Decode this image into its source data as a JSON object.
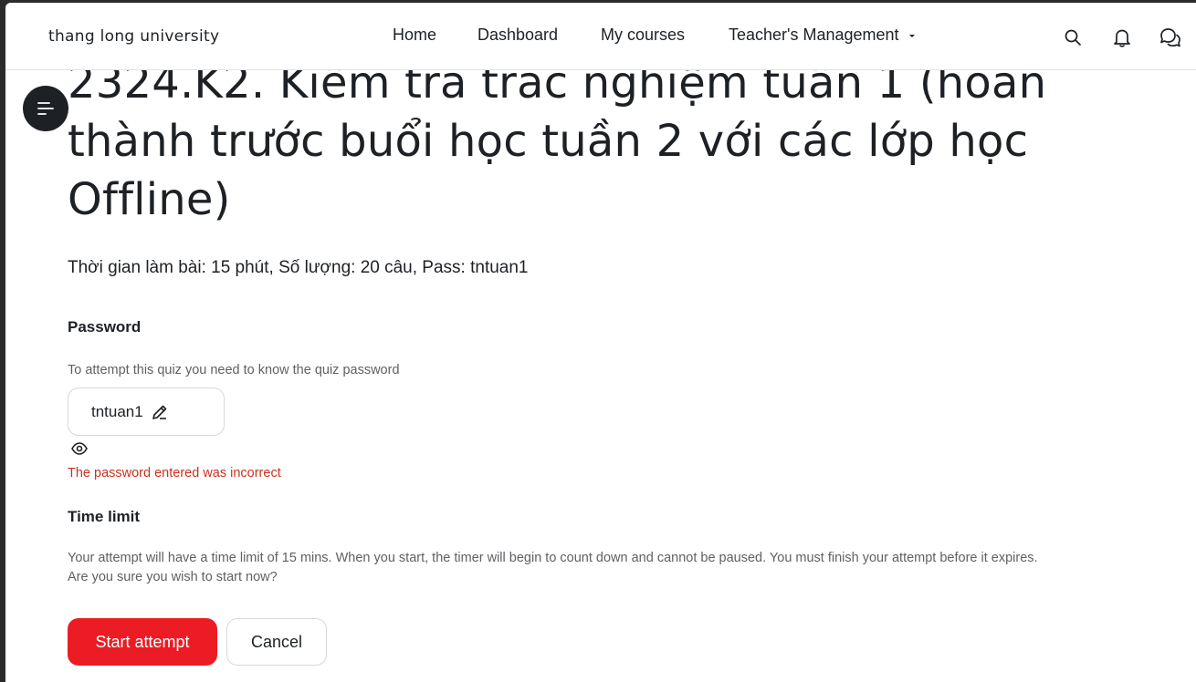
{
  "header": {
    "brand": "thang long university",
    "nav": {
      "home": "Home",
      "dashboard": "Dashboard",
      "my_courses": "My courses",
      "teachers_management": "Teacher's Management"
    },
    "icons": [
      "search-icon",
      "bell-icon",
      "messages-icon"
    ]
  },
  "drawer_toggle_icon": "menu-lines-icon",
  "main": {
    "title": "2324.K2. Kiểm tra trắc nghiệm tuần 1 (hoàn thành trước buổi học tuần 2 với các lớp học Offline)",
    "subtitle": "Thời gian làm bài: 15 phút, Số lượng: 20 câu, Pass: tntuan1",
    "password": {
      "heading": "Password",
      "help": "To attempt this quiz you need to know the quiz password",
      "value": "tntuan1",
      "error": "The password entered was incorrect"
    },
    "time_limit": {
      "heading": "Time limit",
      "help": "Your attempt will have a time limit of 15 mins. When you start, the timer will begin to count down and cannot be paused. You must finish your attempt before it expires. Are you sure you wish to start now?"
    },
    "buttons": {
      "start": "Start attempt",
      "cancel": "Cancel"
    }
  },
  "colors": {
    "primary": "#ec1c24",
    "error": "#ca3120",
    "text": "#1d2125",
    "muted": "#5e6165"
  }
}
